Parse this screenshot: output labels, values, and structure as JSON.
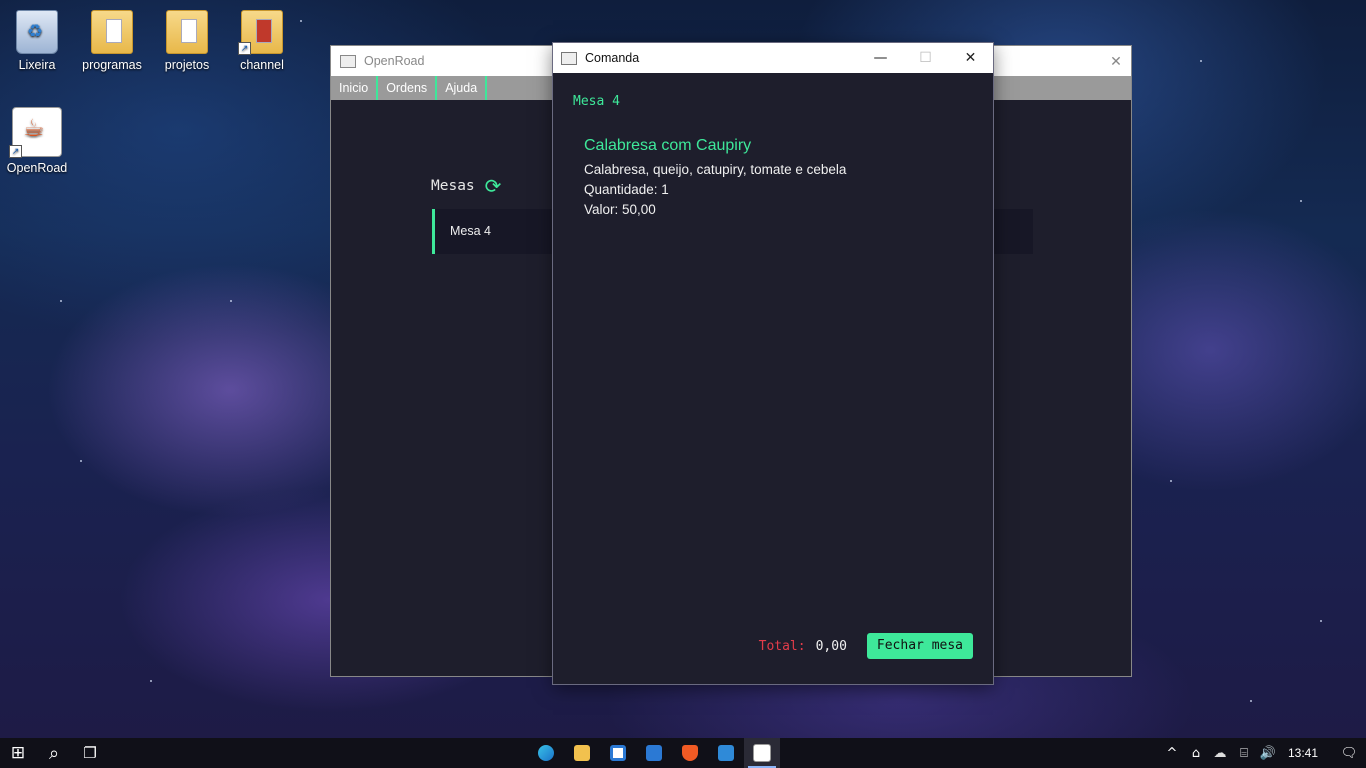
{
  "desktop": {
    "icons": [
      {
        "label": "Lixeira",
        "icon": "recycle-bin-icon"
      },
      {
        "label": "programas",
        "icon": "folder-icon"
      },
      {
        "label": "projetos",
        "icon": "folder-icon"
      },
      {
        "label": "channel",
        "icon": "folder-shortcut-icon"
      },
      {
        "label": "OpenRoad",
        "icon": "java-app-icon"
      }
    ]
  },
  "main_window": {
    "title": "OpenRoad",
    "close_glyph": "✕",
    "menu": [
      "Inicio",
      "Ordens",
      "Ajuda"
    ],
    "section_title": "Mesas",
    "refresh_glyph": "⟳",
    "tables": [
      {
        "label": "Mesa 4"
      }
    ],
    "accent_color": "#3ee89a"
  },
  "comanda_window": {
    "title": "Comanda",
    "controls": {
      "minimize": "—",
      "maximize": "☐",
      "close": "✕"
    },
    "mesa_label": "Mesa 4",
    "items": [
      {
        "name": "Calabresa com Caupiry",
        "description": "Calabresa, queijo, catupiry, tomate e cebela",
        "quantity": "Quantidade: 1",
        "value": "Valor: 50,00"
      }
    ],
    "total_label": "Total:",
    "total_value": "0,00",
    "close_button": "Fechar mesa",
    "total_label_color": "#e23c4a"
  },
  "taskbar": {
    "apps": [
      "windows-start-icon",
      "search-icon",
      "task-view-icon",
      "edge-icon",
      "file-explorer-icon",
      "store-icon",
      "mail-icon",
      "brave-icon",
      "vscode-icon",
      "java-app-icon"
    ],
    "start_glyph": "⊞",
    "search_glyph": "⌕",
    "taskview_glyph": "❐",
    "tray": {
      "chevron": "^",
      "meet": "⌂",
      "onedrive": "☁",
      "network": "⌸",
      "volume": "🔊"
    },
    "clock": "13:41",
    "notification_glyph": "🗨"
  }
}
